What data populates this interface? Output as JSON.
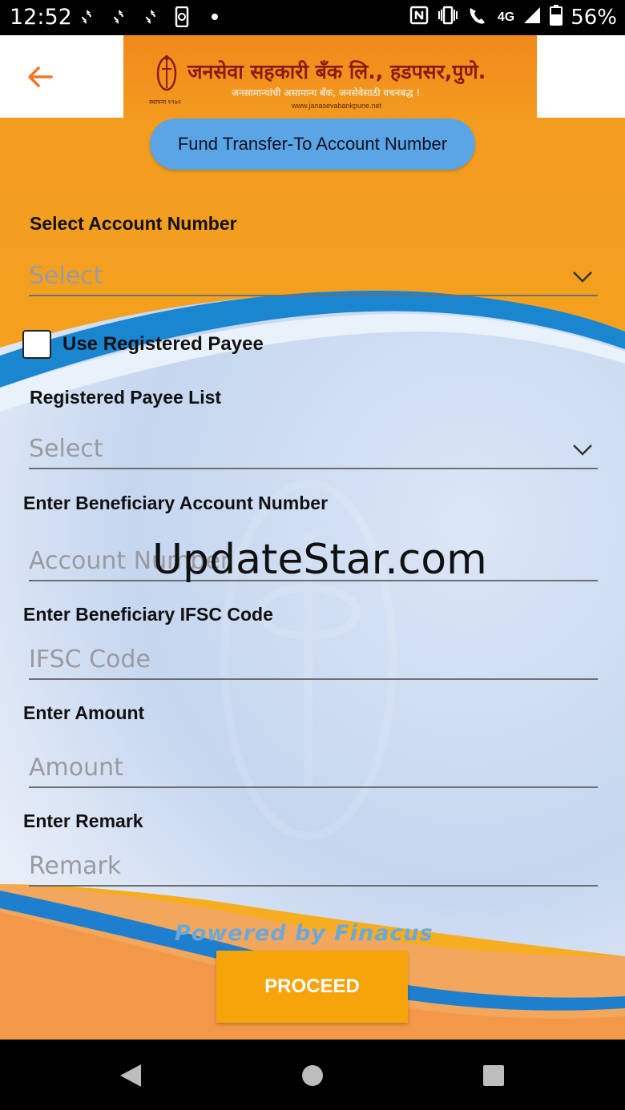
{
  "status_bar": {
    "time": "12:52",
    "battery_percent": "56%",
    "network": "4G",
    "left_icons": [
      "sync-icon",
      "sync-icon",
      "sync-icon",
      "phone-sync-icon",
      "dot-icon"
    ],
    "right_icons": [
      "nfc-icon",
      "vibrate-icon",
      "wifi-call-icon",
      "signal-icon",
      "battery-icon"
    ]
  },
  "header": {
    "bank_name": "जनसेवा सहकारी बँक लि., हडपसर,पुणे.",
    "tagline": "जनसामान्यांची असामान्य बँक, जनसेवेसाठी वचनबद्ध !",
    "website": "www.janasevabankpune.net",
    "est": "स्थापना १९७२"
  },
  "page_title": "Fund Transfer-To Account Number",
  "form": {
    "account_label": "Select Account Number",
    "account_placeholder": "Select",
    "registered_payee_checkbox_label": "Use Registered Payee",
    "registered_payee_checked": false,
    "payee_list_label": "Registered Payee List",
    "payee_list_placeholder": "Select",
    "beneficiary_account_label": "Enter Beneficiary Account Number",
    "beneficiary_account_placeholder": "Account Number",
    "ifsc_label": "Enter Beneficiary IFSC Code",
    "ifsc_placeholder": "IFSC Code",
    "amount_label": "Enter Amount",
    "amount_placeholder": "Amount",
    "remark_label": "Enter Remark",
    "remark_placeholder": "Remark"
  },
  "watermark": "UpdateStar.com",
  "powered_by": "Powered by Finacus",
  "proceed_label": "PROCEED",
  "colors": {
    "accent_orange": "#f7a218",
    "pill_blue": "#5aa5e6",
    "back_arrow": "#f0782a"
  }
}
